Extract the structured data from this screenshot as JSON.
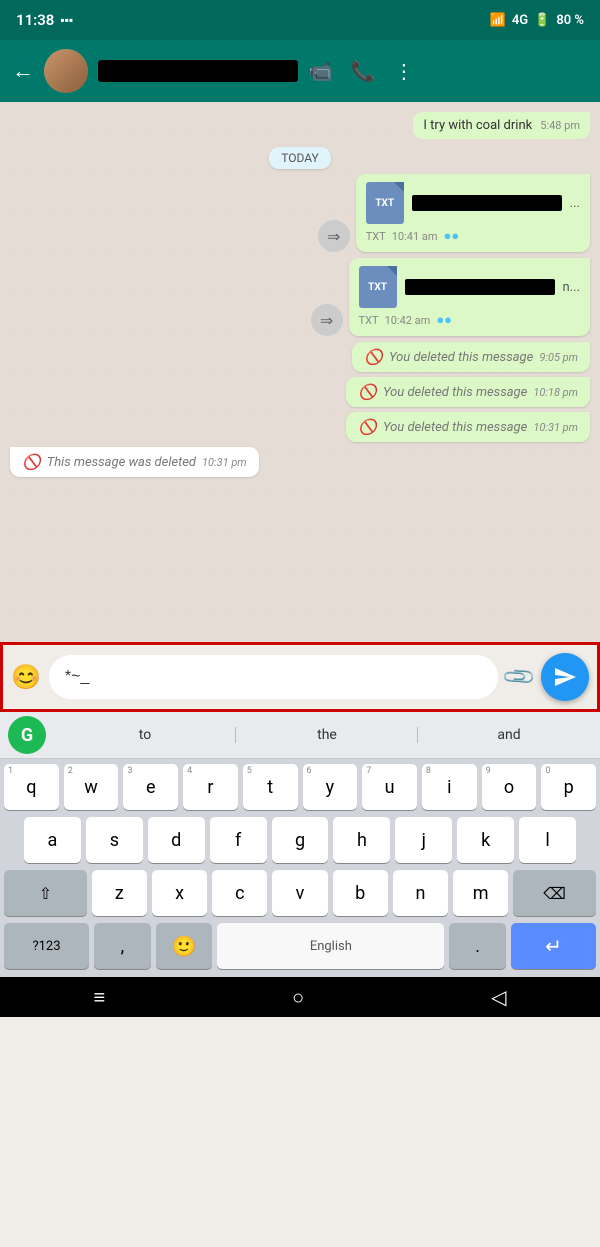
{
  "statusBar": {
    "time": "11:38",
    "signal": "4G",
    "battery": "80 %"
  },
  "topBar": {
    "backLabel": "←",
    "videoCallIcon": "📹",
    "phoneIcon": "📞",
    "menuIcon": "⋮"
  },
  "chat": {
    "dateBadge": "TODAY",
    "stubMessage": {
      "text": "I try with coal drink",
      "time": "5:48 pm"
    },
    "messages": [
      {
        "type": "file",
        "direction": "sent",
        "fileType": "TXT",
        "time": "10:41 am",
        "hasForward": true
      },
      {
        "type": "file",
        "direction": "sent",
        "fileType": "TXT",
        "time": "10:42 am",
        "hasForward": true
      },
      {
        "type": "deleted",
        "direction": "sent",
        "text": "You deleted this message",
        "time": "9:05 pm"
      },
      {
        "type": "deleted",
        "direction": "sent",
        "text": "You deleted this message",
        "time": "10:18 pm"
      },
      {
        "type": "deleted",
        "direction": "sent",
        "text": "You deleted this message",
        "time": "10:31 pm"
      },
      {
        "type": "deleted",
        "direction": "received",
        "text": "This message was deleted",
        "time": "10:31 pm"
      }
    ]
  },
  "inputArea": {
    "placeholder": "",
    "currentText": "*~_",
    "emojiIcon": "😊",
    "attachIcon": "📎"
  },
  "suggestions": {
    "grammarlyLabel": "G",
    "items": [
      "to",
      "the",
      "and"
    ]
  },
  "keyboard": {
    "row1": [
      {
        "label": "q",
        "hint": "1"
      },
      {
        "label": "w",
        "hint": "2"
      },
      {
        "label": "e",
        "hint": "3"
      },
      {
        "label": "r",
        "hint": "4"
      },
      {
        "label": "t",
        "hint": "5"
      },
      {
        "label": "y",
        "hint": "6"
      },
      {
        "label": "u",
        "hint": "7"
      },
      {
        "label": "i",
        "hint": "8"
      },
      {
        "label": "o",
        "hint": "9"
      },
      {
        "label": "p",
        "hint": "0"
      }
    ],
    "row2": [
      {
        "label": "a"
      },
      {
        "label": "s"
      },
      {
        "label": "d"
      },
      {
        "label": "f"
      },
      {
        "label": "g"
      },
      {
        "label": "h"
      },
      {
        "label": "j"
      },
      {
        "label": "k"
      },
      {
        "label": "l"
      }
    ],
    "row3": [
      {
        "label": "z"
      },
      {
        "label": "x"
      },
      {
        "label": "c"
      },
      {
        "label": "v"
      },
      {
        "label": "b"
      },
      {
        "label": "n"
      },
      {
        "label": "m"
      }
    ],
    "bottomRow": {
      "sym": "?123",
      "comma": ",",
      "emojiKey": "🙂",
      "space": "English",
      "period": ".",
      "enter": "↵"
    }
  },
  "navBar": {
    "menuIcon": "≡",
    "homeIcon": "○",
    "backIcon": "◁"
  }
}
